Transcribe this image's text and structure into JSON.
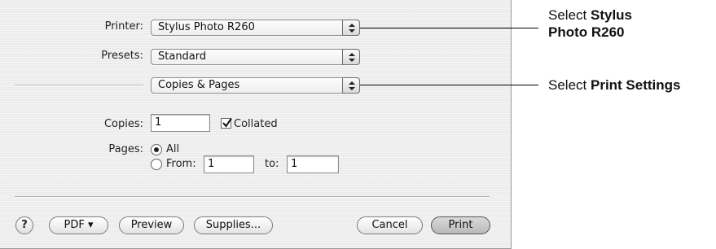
{
  "printer": {
    "label": "Printer:",
    "value": "Stylus Photo R260"
  },
  "presets": {
    "label": "Presets:",
    "value": "Standard"
  },
  "panel": {
    "value": "Copies & Pages"
  },
  "copies": {
    "label": "Copies:",
    "value": "1",
    "collated_label": "Collated",
    "collated": true
  },
  "pages": {
    "label": "Pages:",
    "all_label": "All",
    "from_label": "From:",
    "from_value": "1",
    "to_label": "to:",
    "to_value": "1",
    "selected": "All"
  },
  "buttons": {
    "help": "?",
    "pdf": "PDF ▾",
    "preview": "Preview",
    "supplies": "Supplies...",
    "cancel": "Cancel",
    "print": "Print"
  },
  "callouts": {
    "one_prefix": "Select ",
    "one_bold_a": "Stylus",
    "one_bold_b": "Photo R260",
    "two_prefix": "Select ",
    "two_bold": "Print Settings"
  }
}
